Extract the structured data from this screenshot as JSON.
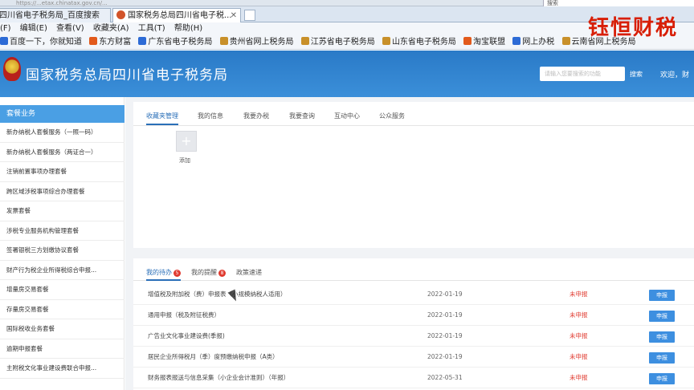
{
  "browser": {
    "url_fragment": "https://...etax.chinatax.gov.cn/...",
    "search_mini": "搜索",
    "tabs": [
      {
        "label": "四川省电子税务局_百度搜索",
        "active": false
      },
      {
        "label": "国家税务总局四川省电子税...",
        "active": true
      }
    ],
    "menu": [
      "(F)",
      "编辑(E)",
      "查看(V)",
      "收藏夹(A)",
      "工具(T)",
      "帮助(H)"
    ],
    "favorites": [
      {
        "label": "百度一下，你就知道",
        "color": "#2d6bd6"
      },
      {
        "label": "东方财富",
        "color": "#e25a1c"
      },
      {
        "label": "广东省电子税务局",
        "color": "#2d6bd6"
      },
      {
        "label": "贵州省网上税务局",
        "color": "#c8902a"
      },
      {
        "label": "江苏省电子税务局",
        "color": "#c8902a"
      },
      {
        "label": "山东省电子税务局",
        "color": "#c8902a"
      },
      {
        "label": "淘宝联盟",
        "color": "#e25a1c"
      },
      {
        "label": "网上办税",
        "color": "#2d6bd6"
      },
      {
        "label": "云南省网上税务局",
        "color": "#c8902a"
      }
    ]
  },
  "watermark": "钰恒财税",
  "header": {
    "title": "国家税务总局四川省电子税务局",
    "search_placeholder": "请输入您要搜索的功能",
    "search_button": "搜索",
    "welcome": "欢迎，财"
  },
  "sidebar": {
    "heading": "套餐业务",
    "items": [
      "新办纳税人套餐服务（一照一码）",
      "新办纳税人套餐服务（两证合一）",
      "注销前置事项办理套餐",
      "跨区域涉税事项综合办理套餐",
      "发票套餐",
      "涉税专业服务机构管理套餐",
      "签署银税三方划缴协议套餐",
      "财产行为税企业所得税综合申报...",
      "增量房交易套餐",
      "存量房交易套餐",
      "国际税收业务套餐",
      "逾期申报套餐",
      "主附税文化事业建设费联合申报..."
    ]
  },
  "top_panel": {
    "tabs": [
      "收藏夹管理",
      "我的信息",
      "我要办税",
      "我要查询",
      "互动中心",
      "公众服务"
    ],
    "add_label": "添加"
  },
  "todo_panel": {
    "tabs": [
      {
        "label": "我的待办",
        "badge": "5"
      },
      {
        "label": "我的提醒",
        "badge": "8"
      },
      {
        "label": "政策速递",
        "badge": ""
      }
    ],
    "rows": [
      {
        "name": "增值税及附加税（费）申报表（小规模纳税人适用）",
        "date": "2022-01-19",
        "status": "未申报",
        "action": "申报"
      },
      {
        "name": "通用申报（税及附征税费）",
        "date": "2022-01-19",
        "status": "未申报",
        "action": "申报"
      },
      {
        "name": "广告业文化事业建设费(季报)",
        "date": "2022-01-19",
        "status": "未申报",
        "action": "申报"
      },
      {
        "name": "居民企业所得税月（季）度预缴纳税申报（A类）",
        "date": "2022-01-19",
        "status": "未申报",
        "action": "申报"
      },
      {
        "name": "财务报表报送与信息采集（小企业会计准则）（年报）",
        "date": "2022-05-31",
        "status": "未申报",
        "action": "申报"
      }
    ]
  },
  "colors": {
    "header_blue": "#3b8fd9",
    "accent": "#2a6fb8",
    "alert_red": "#e03a2f",
    "button_blue": "#3d8fe0"
  }
}
